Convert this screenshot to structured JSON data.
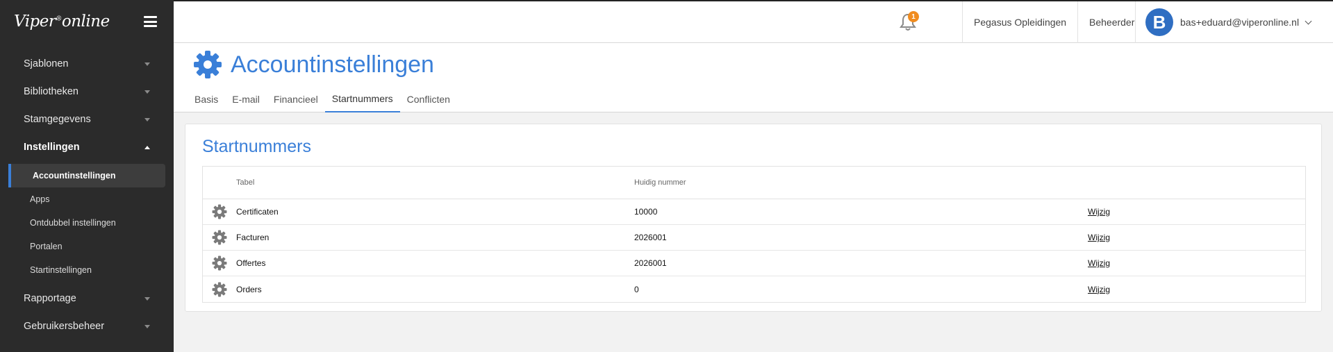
{
  "sidebar": {
    "logo": "Viper",
    "logo_mark": "®",
    "logo_suffix": "online",
    "items": [
      {
        "label": "Sjablonen"
      },
      {
        "label": "Bibliotheken"
      },
      {
        "label": "Stamgegevens"
      },
      {
        "label": "Instellingen"
      },
      {
        "label": "Rapportage"
      },
      {
        "label": "Gebruikersbeheer"
      }
    ],
    "sub_items": [
      {
        "label": "Accountinstellingen"
      },
      {
        "label": "Apps"
      },
      {
        "label": "Ontdubbel instellingen"
      },
      {
        "label": "Portalen"
      },
      {
        "label": "Startinstellingen"
      }
    ]
  },
  "header": {
    "notification_count": "1",
    "organization": "Pegasus Opleidingen",
    "role": "Beheerder",
    "avatar_letter": "B",
    "user_email": "bas+eduard@viperonline.nl"
  },
  "page": {
    "title": "Accountinstellingen",
    "tabs": [
      {
        "label": "Basis"
      },
      {
        "label": "E-mail"
      },
      {
        "label": "Financieel"
      },
      {
        "label": "Startnummers"
      },
      {
        "label": "Conflicten"
      }
    ],
    "active_tab": "Startnummers"
  },
  "section": {
    "title": "Startnummers",
    "columns": {
      "name": "Tabel",
      "number": "Huidig nummer"
    },
    "rows": [
      {
        "name": "Certificaten",
        "number": "10000",
        "action": "Wijzig"
      },
      {
        "name": "Facturen",
        "number": "2026001",
        "action": "Wijzig"
      },
      {
        "name": "Offertes",
        "number": "2026001",
        "action": "Wijzig"
      },
      {
        "name": "Orders",
        "number": "0",
        "action": "Wijzig"
      }
    ]
  },
  "colors": {
    "accent": "#3a7fd8",
    "sidebar_bg": "#2b2b2b",
    "badge": "#f08c1f",
    "gear": "#7a7a7a"
  },
  "icons": {
    "menu": "hamburger-icon",
    "notifications": "bell-icon",
    "settings": "gear-icon",
    "dropdown": "chevron-down-icon"
  }
}
